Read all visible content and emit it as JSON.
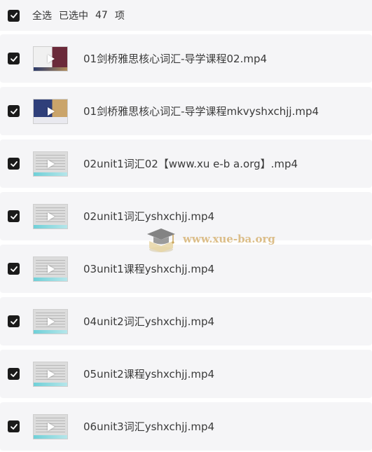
{
  "header": {
    "select_all_label": "全选",
    "selected_prefix": "已选中",
    "selected_count": "47",
    "selected_suffix": "项"
  },
  "files": [
    {
      "name": "01剑桥雅思核心词汇-导学课程02.mp4",
      "thumb": "dark"
    },
    {
      "name": "01剑桥雅思核心词汇-导学课程mkvyshxchjj.mp4",
      "thumb": "navy"
    },
    {
      "name": "02unit1词汇02【www.xu e-b a.org】.mp4",
      "thumb": "light"
    },
    {
      "name": "02unit1词汇yshxchjj.mp4",
      "thumb": "light"
    },
    {
      "name": "03unit1课程yshxchjj.mp4",
      "thumb": "light"
    },
    {
      "name": "04unit2词汇yshxchjj.mp4",
      "thumb": "light"
    },
    {
      "name": "05unit2课程yshxchjj.mp4",
      "thumb": "light"
    },
    {
      "name": "06unit3词汇yshxchjj.mp4",
      "thumb": "light"
    }
  ],
  "watermark": {
    "text": "www.xue-ba.org"
  },
  "colors": {
    "row_background": "#f5f5f7",
    "checkbox": "#1b1b1b",
    "watermark": "#d9b77c"
  }
}
